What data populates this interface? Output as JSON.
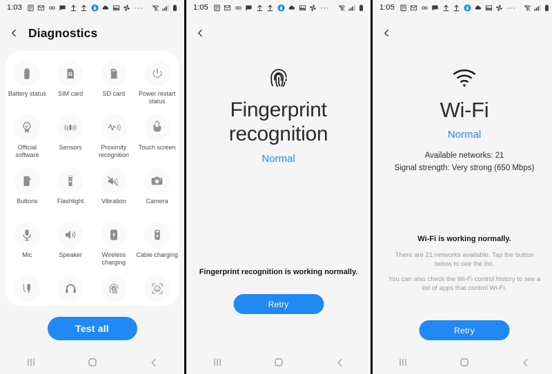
{
  "panels": [
    {
      "id": "diagnostics",
      "statusbar": {
        "clock": "1:03",
        "icons": [
          "article-icon",
          "gmail-icon",
          "infinity-icon",
          "message-icon",
          "upload-icon",
          "upload-alt-icon",
          "lock-badge-icon",
          "cloud-icon",
          "photo-icon",
          "pinwheel-icon"
        ],
        "more": "···",
        "right_icons": [
          "wifi-off-icon",
          "signal-icon",
          "battery-icon"
        ]
      },
      "appbar": {
        "back": "back-icon",
        "title": "Diagnostics"
      },
      "grid": [
        {
          "icon": "battery-icon",
          "label": "Battery status"
        },
        {
          "icon": "sim-card-icon",
          "label": "SIM card"
        },
        {
          "icon": "sd-card-icon",
          "label": "SD card"
        },
        {
          "icon": "power-icon",
          "label": "Power restart status"
        },
        {
          "icon": "verified-icon",
          "label": "Official software"
        },
        {
          "icon": "sensors-icon",
          "label": "Sensors"
        },
        {
          "icon": "proximity-icon",
          "label": "Proximity recognition"
        },
        {
          "icon": "touch-icon",
          "label": "Touch screen"
        },
        {
          "icon": "buttons-icon",
          "label": "Buttons"
        },
        {
          "icon": "flashlight-icon",
          "label": "Flashlight"
        },
        {
          "icon": "vibration-icon",
          "label": "Vibration"
        },
        {
          "icon": "camera-icon",
          "label": "Camera"
        },
        {
          "icon": "mic-icon",
          "label": "Mic"
        },
        {
          "icon": "speaker-icon",
          "label": "Speaker"
        },
        {
          "icon": "wireless-charging-icon",
          "label": "Wireless charging"
        },
        {
          "icon": "cable-charging-icon",
          "label": "Cable charging"
        },
        {
          "icon": "earphone-jack-icon",
          "label": ""
        },
        {
          "icon": "headphones-icon",
          "label": ""
        },
        {
          "icon": "fingerprint-icon",
          "label": ""
        },
        {
          "icon": "face-recognition-icon",
          "label": ""
        }
      ],
      "test_all_label": "Test all"
    },
    {
      "id": "fingerprint",
      "statusbar": {
        "clock": "1:05",
        "more": "···"
      },
      "appbar": {
        "back": "back-icon",
        "title": ""
      },
      "hero": {
        "icon": "fingerprint-icon",
        "title": "Fingerprint recognition",
        "status": "Normal",
        "status_color": "#2089f3"
      },
      "summary": "Fingerprint recognition is working normally.",
      "retry_label": "Retry"
    },
    {
      "id": "wifi",
      "statusbar": {
        "clock": "1:05",
        "more": "···"
      },
      "appbar": {
        "back": "back-icon",
        "title": ""
      },
      "hero": {
        "icon": "wifi-icon",
        "title": "Wi-Fi",
        "status": "Normal",
        "status_color": "#2089f3",
        "detail_line_1": "Available networks: 21",
        "detail_line_2": "Signal strength: Very strong (650 Mbps)"
      },
      "summary": "Wi-Fi is working normally.",
      "note_1": "There are 21 networks available. Tap the button below to see the list.",
      "note_2": "You can also check the Wi-Fi control history to see a list of apps that control Wi-Fi.",
      "retry_label": "Retry"
    }
  ],
  "navbar": {
    "recents": "recents-icon",
    "home": "home-icon",
    "back": "back-icon"
  },
  "colors": {
    "accent": "#2089f3",
    "card": "#ffffff",
    "background": "#f5f5f5"
  }
}
